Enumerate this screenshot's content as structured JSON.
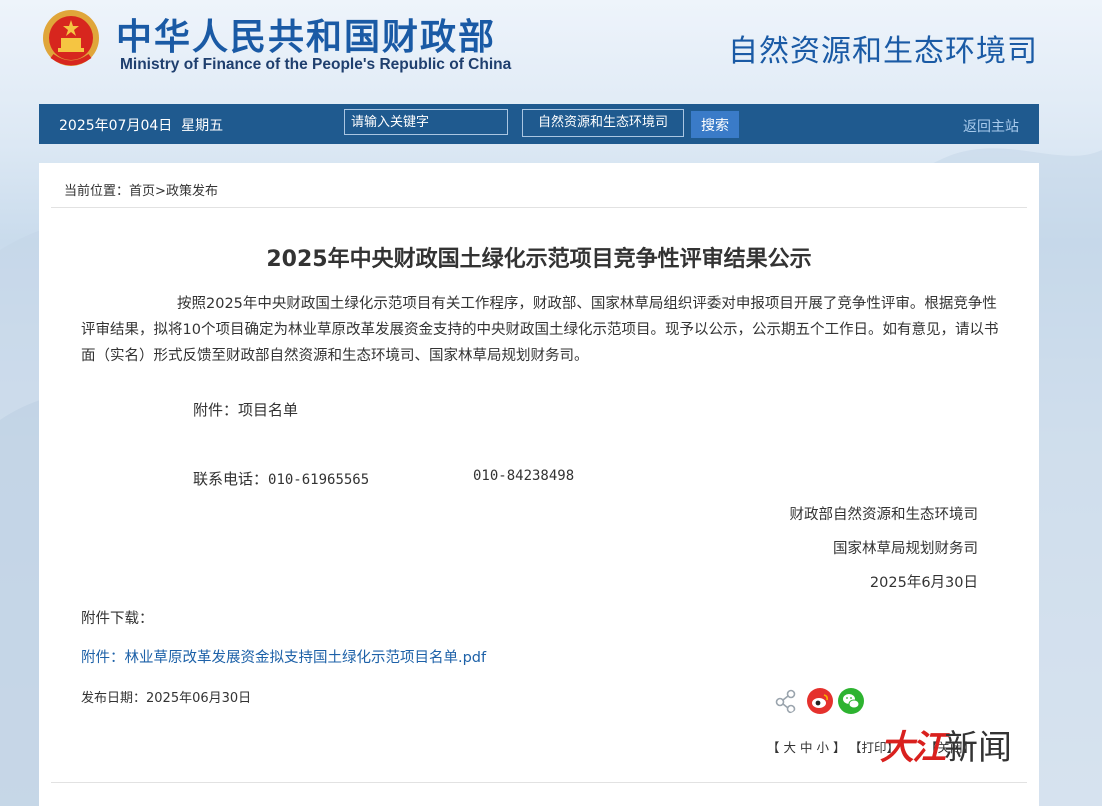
{
  "header": {
    "title_cn": "中华人民共和国财政部",
    "title_en": "Ministry of Finance of the People's Republic of China",
    "department": "自然资源和生态环境司"
  },
  "nav": {
    "date": "2025年07月04日",
    "weekday": "星期五",
    "search_placeholder": "请输入关键字",
    "scope_selected": "自然资源和生态环境司",
    "search_button": "搜索",
    "home_link": "返回主站"
  },
  "breadcrumb": {
    "prefix": "当前位置：",
    "home": "首页",
    "sep": ">",
    "current": "政策发布"
  },
  "article": {
    "title": "2025年中央财政国土绿化示范项目竞争性评审结果公示",
    "body": "按照2025年中央财政国土绿化示范项目有关工作程序，财政部、国家林草局组织评委对申报项目开展了竞争性评审。根据竞争性评审结果，拟将10个项目确定为林业草原改革发展资金支持的中央财政国土绿化示范项目。现予以公示，公示期五个工作日。如有意见，请以书面（实名）形式反馈至财政部自然资源和生态环境司、国家林草局规划财务司。",
    "attachment_line": "附件：项目名单",
    "contact_label": "联系电话：",
    "phone_1": "010-61965565",
    "phone_2": "010-84238498",
    "signer_1": "财政部自然资源和生态环境司",
    "signer_2": "国家林草局规划财务司",
    "sign_date": "2025年6月30日",
    "download_label": "附件下载：",
    "download_link": "附件：林业草原改革发展资金拟支持国土绿化示范项目名单.pdf",
    "publish_date": "发布日期：2025年06月30日"
  },
  "tools": {
    "font_open": "【",
    "font_large": "大",
    "font_medium": "中",
    "font_small": "小",
    "font_close": "】",
    "print": "【打印】",
    "close": "【关闭】"
  },
  "watermark": {
    "brand": "大江",
    "rest": "新闻"
  },
  "colors": {
    "brand_blue": "#1a5aa5",
    "nav_bg": "#1f5a8f",
    "link": "#1d61a8",
    "weibo": "#e5312d",
    "wechat": "#2db330"
  }
}
